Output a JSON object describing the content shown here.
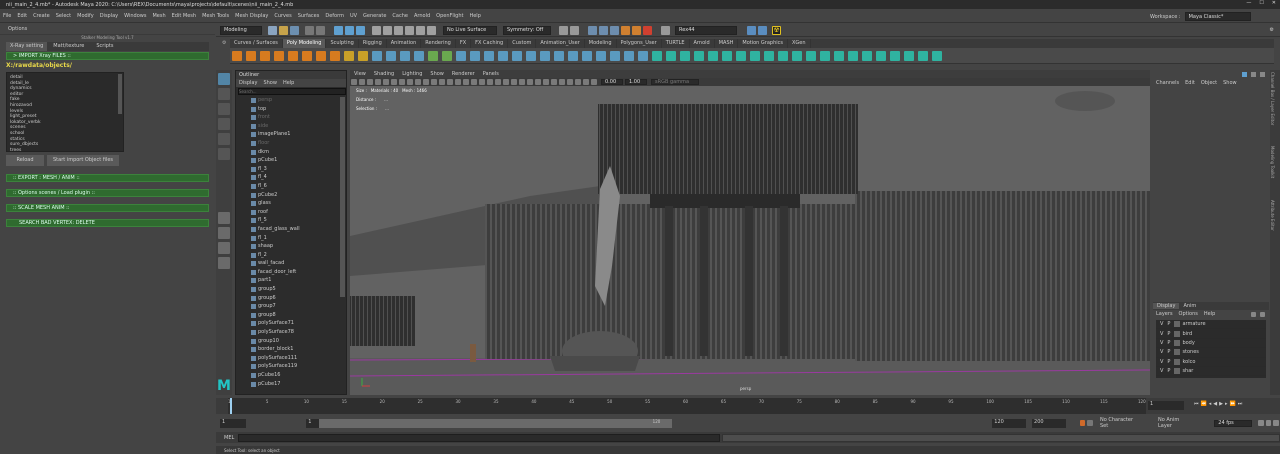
{
  "title_bar": {
    "text": "nii_main_2_4.mb* - Autodesk Maya 2020: C:\\Users\\REX\\Documents\\maya\\projects\\default\\scenes\\nii_main_2_4.mb"
  },
  "menu": [
    "File",
    "Edit",
    "Create",
    "Select",
    "Modify",
    "Display",
    "Windows",
    "Mesh",
    "Edit Mesh",
    "Mesh Tools",
    "Mesh Display",
    "Curves",
    "Surfaces",
    "Deform",
    "UV",
    "Generate",
    "Cache",
    "Arnold",
    "OpenFlight",
    "Help"
  ],
  "workspace": {
    "label": "Workspace :",
    "value": "Maya Classic*"
  },
  "status_line": {
    "mode": "Modeling",
    "live_surface": "No Live Surface",
    "symmetry": "Symmetry: Off",
    "user": "Rex44"
  },
  "shelf_tabs": [
    "Curves / Surfaces",
    "Poly Modeling",
    "Sculpting",
    "Rigging",
    "Animation",
    "Rendering",
    "FX",
    "FX Caching",
    "Custom",
    "Animation_User",
    "Modeling",
    "Polygons_User",
    "TURTLE",
    "Arnold",
    "MASH",
    "Motion Graphics",
    "XGen"
  ],
  "shelf_selected": "Poly Modeling",
  "left_panel": {
    "options_label": "Options",
    "plugin_title": "Stalker Modeling Tool v1.7",
    "tabs": [
      "X-Ray setting",
      "Matt/texture",
      "Scripts"
    ],
    "import_header": "> IMPORT Xray FILES ::",
    "path": "X:/rawdata/objects/",
    "list": [
      "detail",
      "detail_le",
      "dynamics",
      "editor",
      "fake",
      "hirozavod",
      "levels",
      "light_preset",
      "lokator_verbk",
      "scenes",
      "school",
      "statics",
      "sure_dbjects",
      "trees"
    ],
    "reload_btn": "Reload",
    "start_btn": "Start import Object files",
    "sections": [
      ":: EXPORT : MESH / ANIM ::",
      ":: Options scenes / Load plugin ::",
      ":: SCALE MESH ANIM ::"
    ],
    "search_btn": "SEARCH BAD VERTEX: DELETE"
  },
  "outliner": {
    "title": "Outliner",
    "menu": [
      "Display",
      "Show",
      "Help"
    ],
    "search_placeholder": "Search...",
    "items": [
      {
        "name": "persp",
        "dim": true
      },
      {
        "name": "top",
        "dim": false
      },
      {
        "name": "front",
        "dim": true
      },
      {
        "name": "side",
        "dim": true
      },
      {
        "name": "imagePlane1",
        "dim": false
      },
      {
        "name": "floor",
        "dim": true
      },
      {
        "name": "dkm",
        "dim": false
      },
      {
        "name": "pCube1",
        "dim": false
      },
      {
        "name": "fl_3",
        "dim": false
      },
      {
        "name": "fl_4",
        "dim": false
      },
      {
        "name": "fl_6",
        "dim": false
      },
      {
        "name": "pCube2",
        "dim": false
      },
      {
        "name": "glass",
        "dim": false
      },
      {
        "name": "roof",
        "dim": false
      },
      {
        "name": "fl_5",
        "dim": false
      },
      {
        "name": "facad_glass_wall",
        "dim": false
      },
      {
        "name": "fl_1",
        "dim": false
      },
      {
        "name": "shaap",
        "dim": false
      },
      {
        "name": "fl_2",
        "dim": false
      },
      {
        "name": "wall_facad",
        "dim": false
      },
      {
        "name": "facad_door_left",
        "dim": false
      },
      {
        "name": "part1",
        "dim": false
      },
      {
        "name": "group5",
        "dim": false
      },
      {
        "name": "group6",
        "dim": false
      },
      {
        "name": "group7",
        "dim": false
      },
      {
        "name": "group8",
        "dim": false
      },
      {
        "name": "polySurface71",
        "dim": false
      },
      {
        "name": "polySurface78",
        "dim": false
      },
      {
        "name": "group10",
        "dim": false
      },
      {
        "name": "border_block1",
        "dim": false
      },
      {
        "name": "polySurface111",
        "dim": false
      },
      {
        "name": "polySurface119",
        "dim": false
      },
      {
        "name": "pCube16",
        "dim": false
      },
      {
        "name": "pCube17",
        "dim": false
      }
    ]
  },
  "viewport": {
    "menu": [
      "View",
      "Shading",
      "Lighting",
      "Show",
      "Renderer",
      "Panels"
    ],
    "field_a": "0.00",
    "field_b": "1.00",
    "colorspace": "sRGB gamma",
    "hud": {
      "size_label": "Size :",
      "materials": "Materials : 40",
      "mesh": "Mesh : 1466",
      "distance_label": "Distance :",
      "distance_val": "...",
      "selection_label": "Selection :",
      "selection_val": "..."
    },
    "camera": "persp"
  },
  "channel_box": {
    "menu": [
      "Channels",
      "Edit",
      "Object",
      "Show"
    ],
    "side_labels": [
      "Channel Box / Layer Editor",
      "Modeling Toolkit",
      "Attribute Editor"
    ],
    "tabs": [
      "Display",
      "Anim"
    ],
    "layer_menu": [
      "Layers",
      "Options",
      "Help"
    ],
    "layers": [
      "armature",
      "bird",
      "body",
      "stones",
      "kolco",
      "shar",
      "bazis"
    ]
  },
  "timeline": {
    "ticks": [
      "1",
      "5",
      "10",
      "15",
      "20",
      "25",
      "30",
      "35",
      "40",
      "45",
      "50",
      "55",
      "60",
      "65",
      "70",
      "75",
      "80",
      "85",
      "90",
      "95",
      "100",
      "105",
      "110",
      "115",
      "120"
    ],
    "current": "1"
  },
  "range": {
    "start": "1",
    "inner_start": "1",
    "inner_end": "120",
    "end": "120",
    "anim_end": "200",
    "character": "No Character Set",
    "anim_layer": "No Anim Layer",
    "fps": "24 fps"
  },
  "command_line": {
    "label": "MEL"
  },
  "help_line": "Select Tool: select an object",
  "colors": {
    "green_bar": "#2f6b2f",
    "path_text": "#e8d84a",
    "highlight": "#5285a6"
  }
}
